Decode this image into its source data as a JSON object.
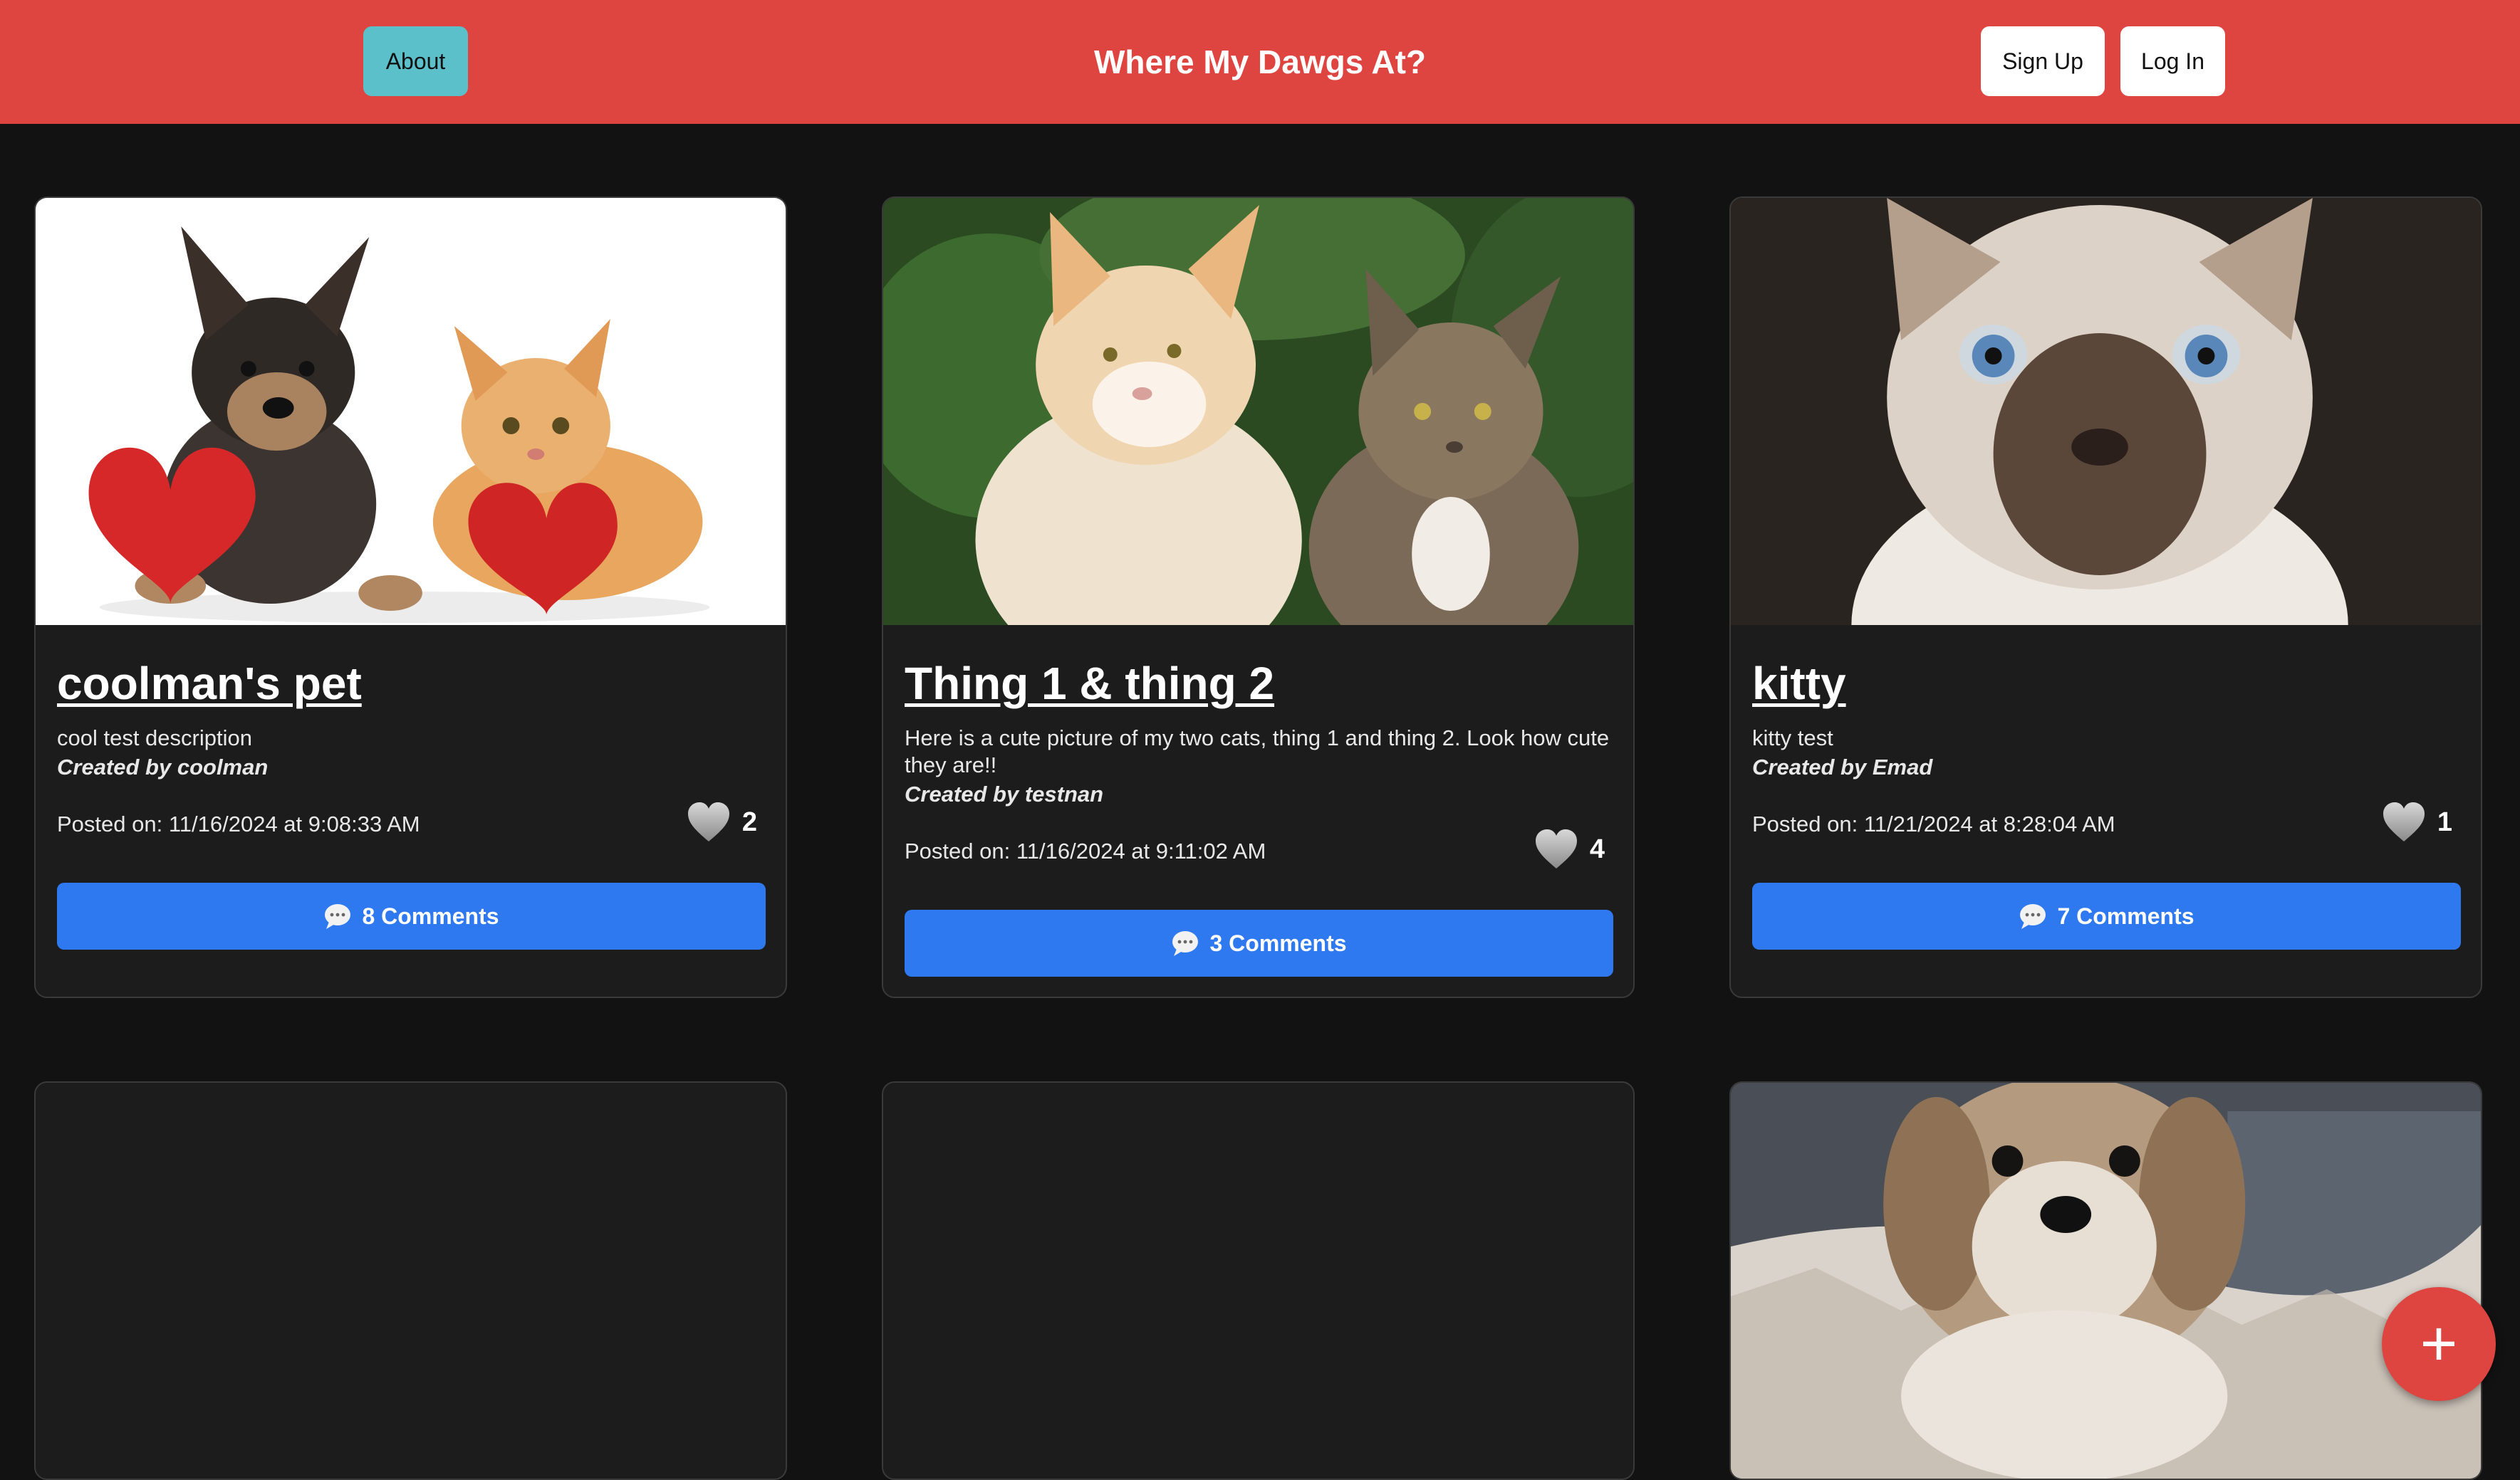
{
  "navbar": {
    "about_label": "About",
    "title": "Where My Dawgs At?",
    "signup_label": "Sign Up",
    "login_label": "Log In"
  },
  "posts": [
    {
      "title": "coolman's pet",
      "description": "cool test description",
      "author": "Created by coolman",
      "posted": "Posted on: 11/16/2024 at 9:08:33 AM",
      "likes": "2",
      "comments_label": "8 Comments",
      "image": "puppy-and-kitten-with-red-hearts"
    },
    {
      "title": "Thing 1 & thing 2",
      "description": "Here is a cute picture of my two cats, thing 1 and thing 2. Look how cute they are!!",
      "author": "Created by testnan",
      "posted": "Posted on: 11/16/2024 at 9:11:02 AM",
      "likes": "4",
      "comments_label": "3 Comments",
      "image": "two-cats-in-garden"
    },
    {
      "title": "kitty",
      "description": "kitty test",
      "author": "Created by Emad",
      "posted": "Posted on: 11/21/2024 at 8:28:04 AM",
      "likes": "1",
      "comments_label": "7 Comments",
      "image": "blue-eyed-kitten"
    },
    {
      "image": "empty"
    },
    {
      "image": "empty"
    },
    {
      "image": "shih-tzu-dog-on-blanket"
    }
  ],
  "icons": {
    "like": "heart-icon",
    "comments": "speech-bubble-icon",
    "add": "plus-icon"
  },
  "fab_label": "+",
  "colors": {
    "navbar": "#de4540",
    "about_button": "#5cc0cb",
    "comments_button": "#2f79f0",
    "background": "#121212",
    "card": "#1c1c1c"
  }
}
